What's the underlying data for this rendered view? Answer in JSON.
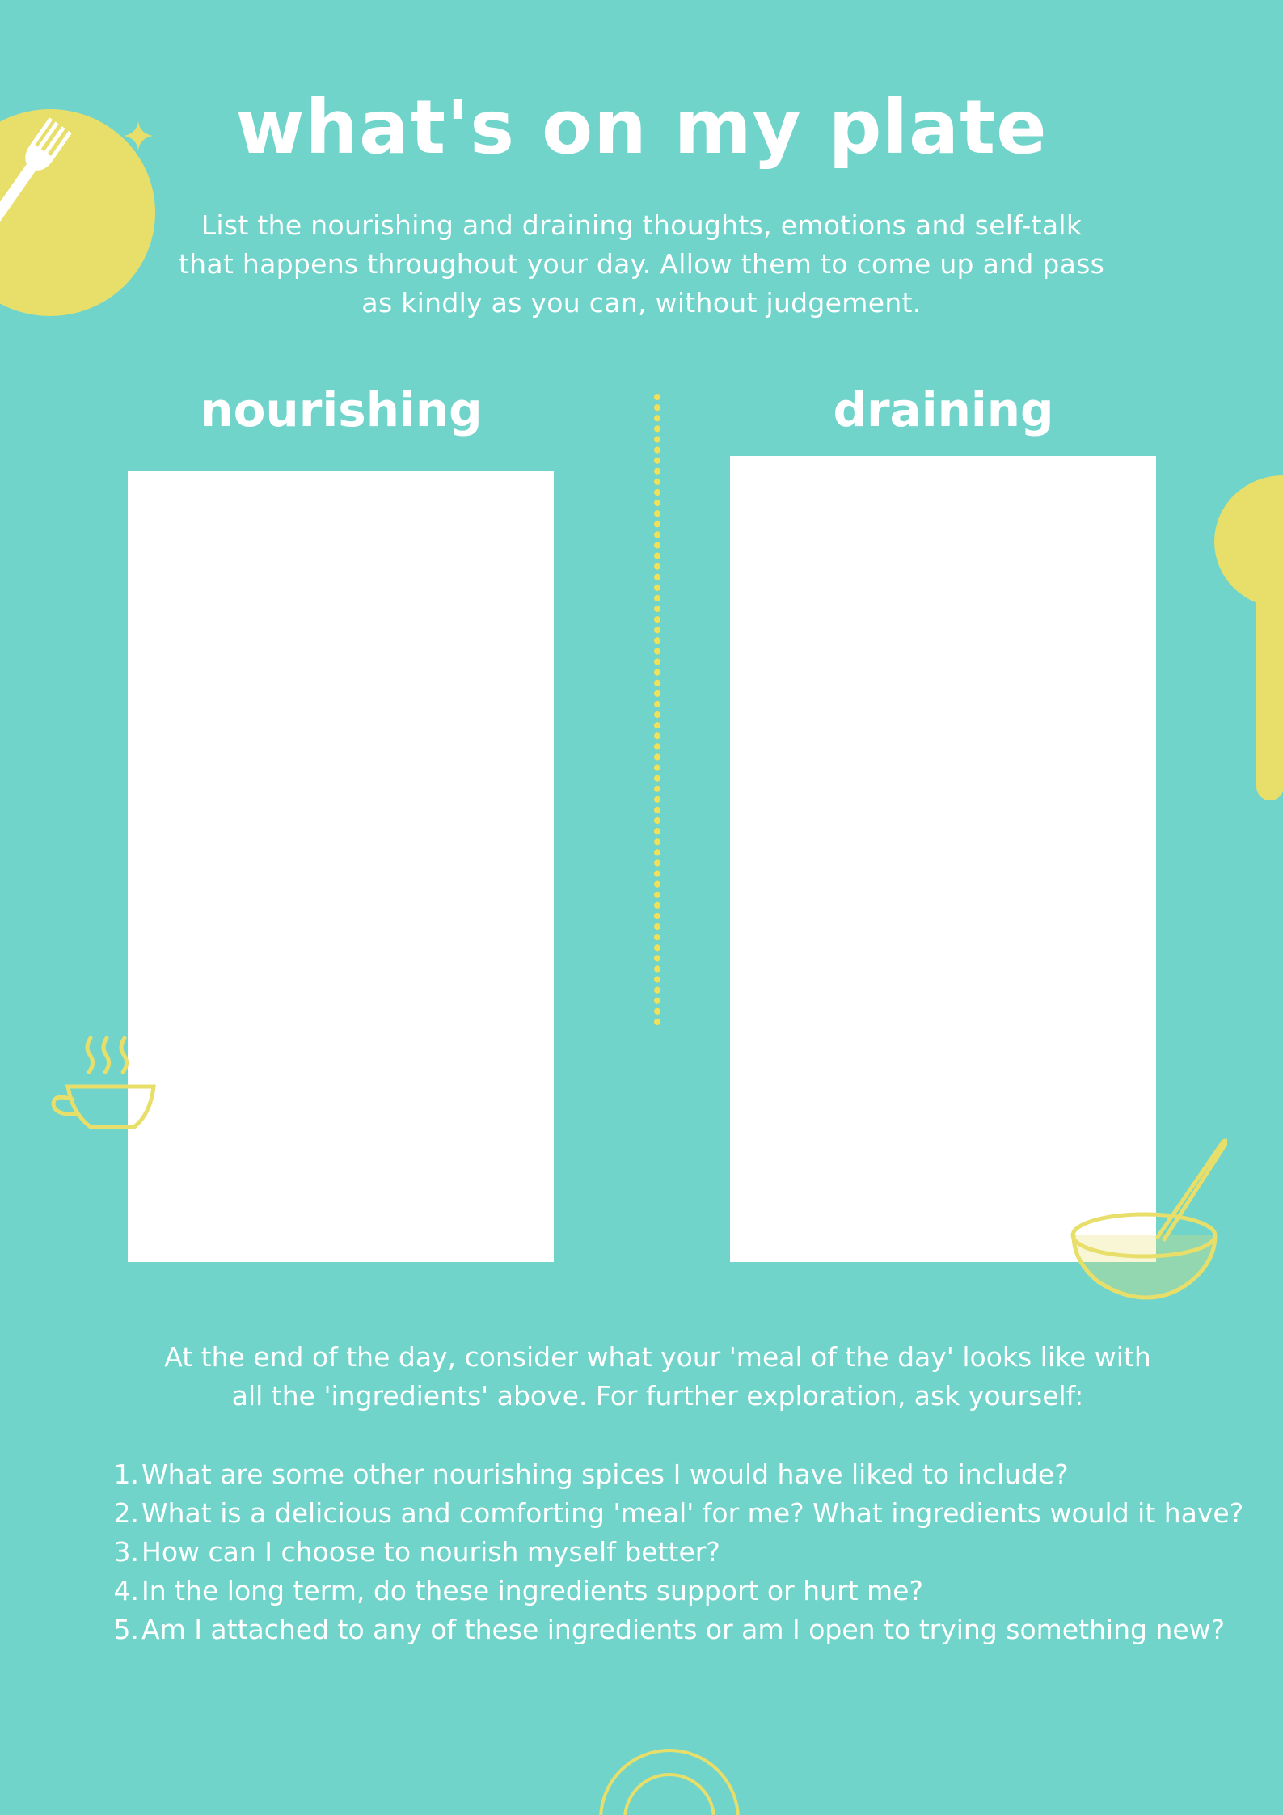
{
  "page": {
    "title": "what's on my plate",
    "intro": "List the nourishing and draining thoughts, emotions and self-talk that happens throughout your day. Allow them to come up and pass as kindly as you can, without judgement."
  },
  "columns": {
    "left_heading": "nourishing",
    "right_heading": "draining"
  },
  "closing": {
    "text": "At the end of the day, consider what your 'meal of the day' looks like with all the 'ingredients' above. For further exploration, ask yourself:"
  },
  "questions": [
    {
      "number": "1.",
      "text": "What are some other nourishing spices I would have liked to include?"
    },
    {
      "number": "2.",
      "text": "What is a delicious and comforting 'meal' for me? What ingredients would it have?"
    },
    {
      "number": "3.",
      "text": "How can I choose to nourish myself better?"
    },
    {
      "number": "4.",
      "text": "In the long term, do these ingredients support or hurt me?"
    },
    {
      "number": "5.",
      "text": "Am I attached to any of these ingredients or am I open to trying something new?"
    }
  ],
  "colors": {
    "background": "#71d4cb",
    "accent_yellow": "#e8de6a",
    "text": "#ffffff"
  },
  "icons": [
    "plate-fork-icon",
    "sparkle-icon",
    "spoon-icon",
    "teacup-icon",
    "bowl-spoon-icon",
    "plate-outline-icon"
  ]
}
